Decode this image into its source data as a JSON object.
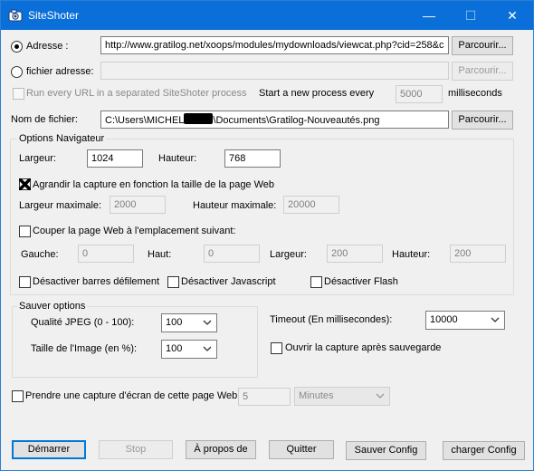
{
  "window": {
    "title": "SiteShoter",
    "minimize_glyph": "—",
    "maximize_glyph": "☐",
    "close_glyph": "✕"
  },
  "source": {
    "url_radio_label": "Adresse :",
    "url_value": "http://www.gratilog.net/xoops/modules/mydownloads/viewcat.php?cid=258&c",
    "url_browse": "Parcourir...",
    "file_radio_label": "fichier adresse:",
    "file_value": "",
    "file_browse": "Parcourir...",
    "separate_process_label": "Run every URL in a separated SiteShoter process",
    "start_process_label": "Start a new process every",
    "interval_value": "5000",
    "interval_unit": "milliseconds"
  },
  "filename": {
    "label": "Nom de fichier:",
    "value_prefix": "C:\\Users\\MICHEL",
    "value_suffix": "\\Documents\\Gratilog-Nouveautés.png",
    "browse": "Parcourir..."
  },
  "browser": {
    "group_title": "Options Navigateur",
    "width_label": "Largeur:",
    "width_value": "1024",
    "height_label": "Hauteur:",
    "height_value": "768",
    "enlarge_label": "Agrandir la capture en fonction la taille de la page Web",
    "enlarge_checked": true,
    "max_width_label": "Largeur maximale:",
    "max_width_value": "2000",
    "max_height_label": "Hauteur maximale:",
    "max_height_value": "20000",
    "crop_label": "Couper la page Web à l'emplacement suivant:",
    "left_label": "Gauche:",
    "left_value": "0",
    "top_label": "Haut:",
    "top_value": "0",
    "crop_width_label": "Largeur:",
    "crop_width_value": "200",
    "crop_height_label": "Hauteur:",
    "crop_height_value": "200",
    "disable_scrollbars_label": "Désactiver barres défilement",
    "disable_js_label": "Désactiver Javascript",
    "disable_flash_label": "Désactiver Flash"
  },
  "save": {
    "group_title": "Sauver options",
    "jpeg_label": "Qualité JPEG (0 - 100):",
    "jpeg_value": "100",
    "size_label": "Taille de l'Image (en %):",
    "size_value": "100",
    "timeout_label": "Timeout (En millisecondes):",
    "timeout_value": "10000",
    "open_after_label": "Ouvrir la capture après sauvegarde"
  },
  "periodic": {
    "label": "Prendre une capture d'écran de cette page Web",
    "value": "5",
    "unit": "Minutes"
  },
  "buttons": {
    "start": "Démarrer",
    "stop": "Stop",
    "about": "À propos de",
    "quit": "Quitter",
    "save_config": "Sauver Config",
    "load_config": "charger Config"
  }
}
